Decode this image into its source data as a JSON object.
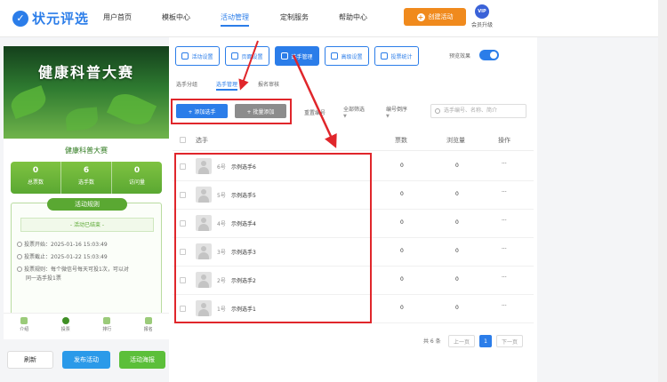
{
  "brand": {
    "logo_text": "状元评选",
    "accent": "#2b7de9"
  },
  "topnav": {
    "items": [
      "用户首页",
      "模板中心",
      "活动管理",
      "定制服务",
      "帮助中心"
    ],
    "active": "活动管理",
    "create_label": "创建活动",
    "vip_badge": "VIP",
    "vip_label": "会员升级"
  },
  "preview": {
    "banner_title": "健康科普大赛",
    "contest_title": "健康科普大赛",
    "stats": [
      {
        "value": "0",
        "label": "总票数"
      },
      {
        "value": "6",
        "label": "选手数"
      },
      {
        "value": "0",
        "label": "访问量"
      }
    ],
    "rules_title": "活动规则",
    "status": "- 活动已结束 -",
    "rule_lines": [
      "投票开始：2025-01-16 15:03:49",
      "投票截止：2025-01-22 15:03:49",
      "投票规则：每个微信号每天可投1次，可以对",
      "同一选手投1票"
    ],
    "bottom_nav": [
      "介绍",
      "投票",
      "排行",
      "报名"
    ]
  },
  "bottom_actions": {
    "refresh": "刷新",
    "publish": "发布活动",
    "poster": "活动海报"
  },
  "toolbar": {
    "tools": [
      "活动设置",
      "页面设置",
      "选手管理",
      "高级设置",
      "投票统计"
    ],
    "active_tool": "选手管理",
    "preview_label": "预览效果",
    "preview_on": true
  },
  "subtabs": {
    "items": [
      "选手分组",
      "选手管理",
      "报名审核"
    ],
    "active": "选手管理"
  },
  "actions": {
    "add": "+ 添加选手",
    "batch": "+ 批量添加",
    "renumber": "重置编号",
    "filter_all": "全部筛选",
    "sort": "编号倒序",
    "search_placeholder": "选手编号、名称、简介"
  },
  "table": {
    "headers": [
      "选手",
      "票数",
      "浏览量",
      "操作"
    ],
    "rows": [
      {
        "number": "6号",
        "name": "示例选手6",
        "votes": "0",
        "views": "0",
        "ops": "···"
      },
      {
        "number": "5号",
        "name": "示例选手5",
        "votes": "0",
        "views": "0",
        "ops": "···"
      },
      {
        "number": "4号",
        "name": "示例选手4",
        "votes": "0",
        "views": "0",
        "ops": "···"
      },
      {
        "number": "3号",
        "name": "示例选手3",
        "votes": "0",
        "views": "0",
        "ops": "···"
      },
      {
        "number": "2号",
        "name": "示例选手2",
        "votes": "0",
        "views": "0",
        "ops": "···"
      },
      {
        "number": "1号",
        "name": "示例选手1",
        "votes": "0",
        "views": "0",
        "ops": "···"
      }
    ]
  },
  "pagination": {
    "total": "共 6 条",
    "prev": "上一页",
    "current": "1",
    "next": "下一页"
  },
  "colors": {
    "orange": "#f08a1d",
    "green": "#5aa832",
    "red_highlight": "#e0262b",
    "gray_button": "#8c8c8c"
  }
}
